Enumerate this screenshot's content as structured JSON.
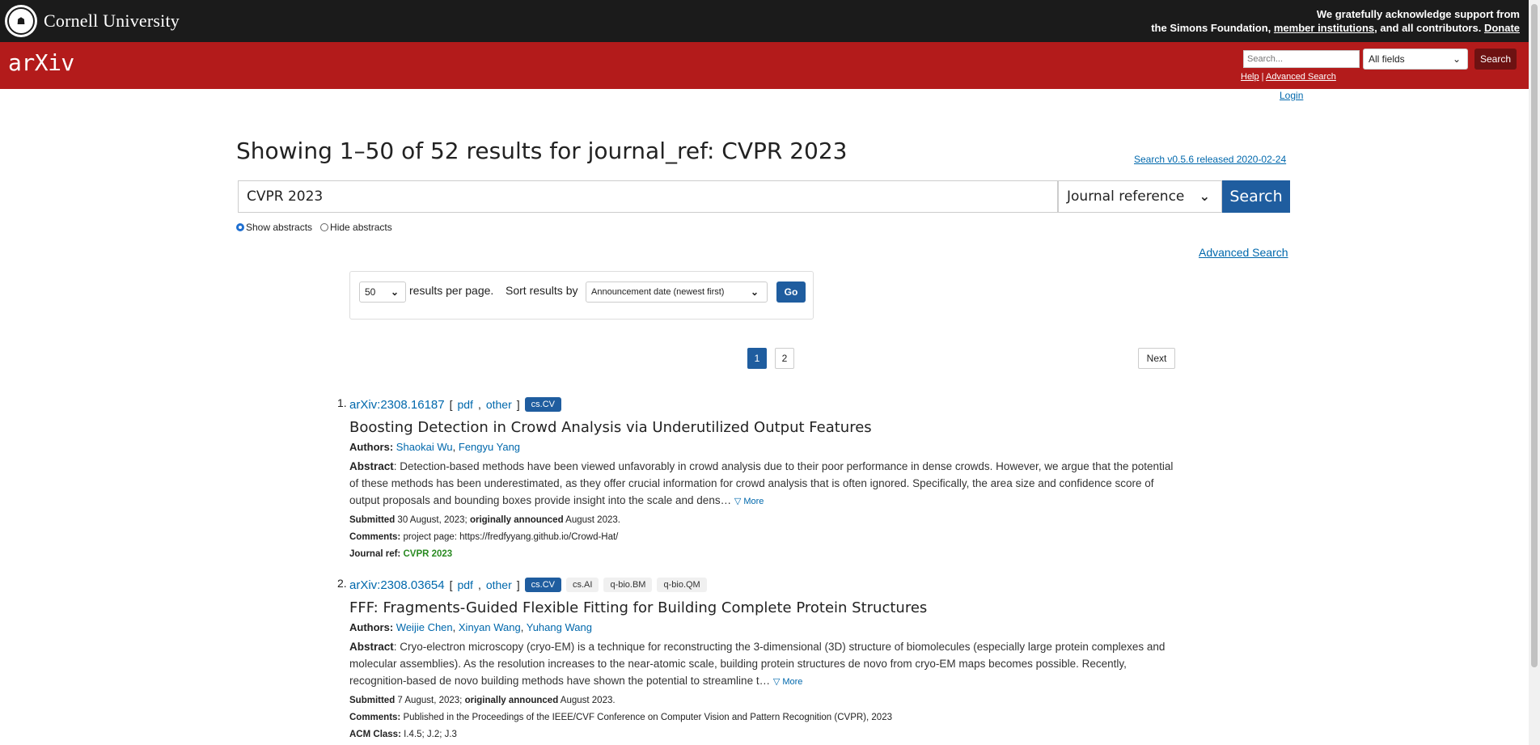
{
  "topbar": {
    "university": "Cornell University",
    "ack_line1_text": "We gratefully acknowledge support from",
    "ack_line2_pre": "the Simons Foundation,",
    "member_link": "member institutions",
    "ack_line2_mid": ", and all contributors.",
    "donate_link": "Donate"
  },
  "header": {
    "logo": "arXiv",
    "search_placeholder": "Search...",
    "field_select": "All fields",
    "search_button": "Search",
    "help_link": "Help",
    "pipe": " | ",
    "advanced_link": "Advanced Search",
    "login_link": "Login"
  },
  "main": {
    "title": "Showing 1–50 of 52 results for journal_ref: CVPR 2023",
    "release_link": "Search v0.5.6 released 2020-02-24",
    "query": "CVPR 2023",
    "field": "Journal reference",
    "search_button": "Search",
    "show_abstracts": "Show abstracts",
    "hide_abstracts": "Hide abstracts",
    "advanced_search": "Advanced Search",
    "per_page_value": "50",
    "per_page_text": "results per page.",
    "sort_label": "Sort results by",
    "sort_value": "Announcement date (newest first)",
    "go_button": "Go",
    "pages": [
      "1",
      "2"
    ],
    "next": "Next"
  },
  "results": [
    {
      "num": "1.",
      "arxiv_id": "arXiv:2308.16187",
      "pdf": "pdf",
      "other": "other",
      "tags_primary": "cs.CV",
      "tags_secondary": [],
      "title": "Boosting Detection in Crowd Analysis via Underutilized Output Features",
      "authors_label": "Authors:",
      "authors": [
        "Shaokai Wu",
        "Fengyu Yang"
      ],
      "abstract_label": "Abstract",
      "abstract": ": Detection-based methods have been viewed unfavorably in crowd analysis due to their poor performance in dense crowds. However, we argue that the potential of these methods has been underestimated, as they offer crucial information for crowd analysis that is often ignored. Specifically, the area size and confidence score of output proposals and bounding boxes provide insight into the scale and dens…",
      "more": "▽ More",
      "submitted_label": "Submitted",
      "submitted": " 30 August, 2023; ",
      "announced_label": "originally announced",
      "announced": " August 2023.",
      "comments_label": "Comments:",
      "comments": " project page: https://fredfyyang.github.io/Crowd-Hat/",
      "jref_label": "Journal ref:",
      "jref": "CVPR 2023"
    },
    {
      "num": "2.",
      "arxiv_id": "arXiv:2308.03654",
      "pdf": "pdf",
      "other": "other",
      "tags_primary": "cs.CV",
      "tags_secondary": [
        "cs.AI",
        "q-bio.BM",
        "q-bio.QM"
      ],
      "title": "FFF: Fragments-Guided Flexible Fitting for Building Complete Protein Structures",
      "authors_label": "Authors:",
      "authors": [
        "Weijie Chen",
        "Xinyan Wang",
        "Yuhang Wang"
      ],
      "abstract_label": "Abstract",
      "abstract": ": Cryo-electron microscopy (cryo-EM) is a technique for reconstructing the 3-dimensional (3D) structure of biomolecules (especially large protein complexes and molecular assemblies). As the resolution increases to the near-atomic scale, building protein structures de novo from cryo-EM maps becomes possible. Recently, recognition-based de novo building methods have shown the potential to streamline t…",
      "more": "▽ More",
      "submitted_label": "Submitted",
      "submitted": " 7 August, 2023; ",
      "announced_label": "originally announced",
      "announced": " August 2023.",
      "comments_label": "Comments:",
      "comments": " Published in the Proceedings of the IEEE/CVF Conference on Computer Vision and Pattern Recognition (CVPR), 2023",
      "acm_label": "ACM Class:",
      "acm": " I.4.5; J.2; J.3"
    }
  ]
}
